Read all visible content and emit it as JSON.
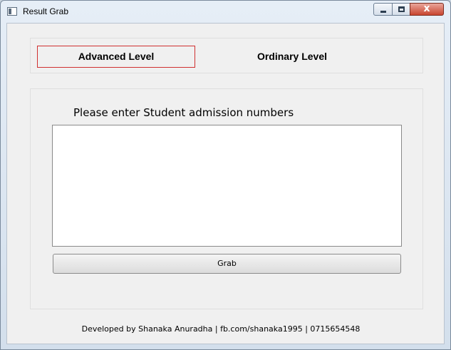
{
  "window": {
    "title": "Result Grab",
    "controls": {
      "minimize_icon": "minimize-icon",
      "maximize_icon": "maximize-icon",
      "close_icon": "close-icon",
      "close_glyph": "x"
    }
  },
  "tabs": [
    {
      "label": "Advanced Level",
      "selected": true
    },
    {
      "label": "Ordinary Level",
      "selected": false
    }
  ],
  "form": {
    "prompt": "Please enter Student admission numbers",
    "input_value": "",
    "grab_label": "Grab"
  },
  "footer": {
    "credit": "Developed by Shanaka Anuradha | fb.com/shanaka1995 | 0715654548"
  },
  "colors": {
    "selected_tab_border": "#d03030",
    "client_background": "#f0f0f0",
    "close_button": "#c8452f"
  }
}
